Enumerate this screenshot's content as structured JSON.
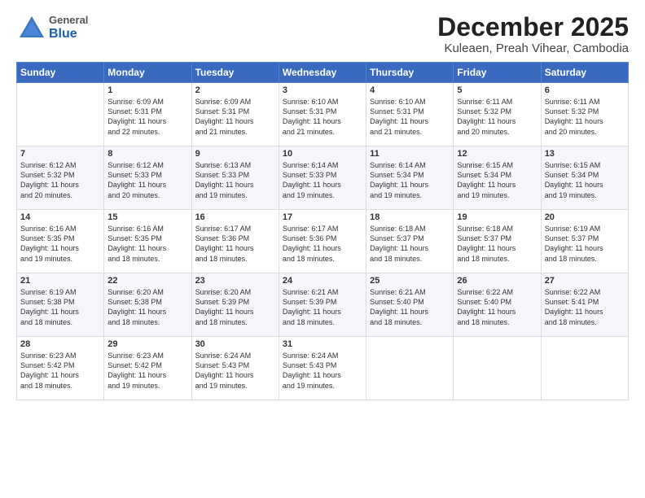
{
  "header": {
    "logo": {
      "general": "General",
      "blue": "Blue"
    },
    "title": "December 2025",
    "subtitle": "Kuleaen, Preah Vihear, Cambodia"
  },
  "calendar": {
    "headers": [
      "Sunday",
      "Monday",
      "Tuesday",
      "Wednesday",
      "Thursday",
      "Friday",
      "Saturday"
    ],
    "weeks": [
      [
        {
          "day": "",
          "info": ""
        },
        {
          "day": "1",
          "info": "Sunrise: 6:09 AM\nSunset: 5:31 PM\nDaylight: 11 hours\nand 22 minutes."
        },
        {
          "day": "2",
          "info": "Sunrise: 6:09 AM\nSunset: 5:31 PM\nDaylight: 11 hours\nand 21 minutes."
        },
        {
          "day": "3",
          "info": "Sunrise: 6:10 AM\nSunset: 5:31 PM\nDaylight: 11 hours\nand 21 minutes."
        },
        {
          "day": "4",
          "info": "Sunrise: 6:10 AM\nSunset: 5:31 PM\nDaylight: 11 hours\nand 21 minutes."
        },
        {
          "day": "5",
          "info": "Sunrise: 6:11 AM\nSunset: 5:32 PM\nDaylight: 11 hours\nand 20 minutes."
        },
        {
          "day": "6",
          "info": "Sunrise: 6:11 AM\nSunset: 5:32 PM\nDaylight: 11 hours\nand 20 minutes."
        }
      ],
      [
        {
          "day": "7",
          "info": "Sunrise: 6:12 AM\nSunset: 5:32 PM\nDaylight: 11 hours\nand 20 minutes."
        },
        {
          "day": "8",
          "info": "Sunrise: 6:12 AM\nSunset: 5:33 PM\nDaylight: 11 hours\nand 20 minutes."
        },
        {
          "day": "9",
          "info": "Sunrise: 6:13 AM\nSunset: 5:33 PM\nDaylight: 11 hours\nand 19 minutes."
        },
        {
          "day": "10",
          "info": "Sunrise: 6:14 AM\nSunset: 5:33 PM\nDaylight: 11 hours\nand 19 minutes."
        },
        {
          "day": "11",
          "info": "Sunrise: 6:14 AM\nSunset: 5:34 PM\nDaylight: 11 hours\nand 19 minutes."
        },
        {
          "day": "12",
          "info": "Sunrise: 6:15 AM\nSunset: 5:34 PM\nDaylight: 11 hours\nand 19 minutes."
        },
        {
          "day": "13",
          "info": "Sunrise: 6:15 AM\nSunset: 5:34 PM\nDaylight: 11 hours\nand 19 minutes."
        }
      ],
      [
        {
          "day": "14",
          "info": "Sunrise: 6:16 AM\nSunset: 5:35 PM\nDaylight: 11 hours\nand 19 minutes."
        },
        {
          "day": "15",
          "info": "Sunrise: 6:16 AM\nSunset: 5:35 PM\nDaylight: 11 hours\nand 18 minutes."
        },
        {
          "day": "16",
          "info": "Sunrise: 6:17 AM\nSunset: 5:36 PM\nDaylight: 11 hours\nand 18 minutes."
        },
        {
          "day": "17",
          "info": "Sunrise: 6:17 AM\nSunset: 5:36 PM\nDaylight: 11 hours\nand 18 minutes."
        },
        {
          "day": "18",
          "info": "Sunrise: 6:18 AM\nSunset: 5:37 PM\nDaylight: 11 hours\nand 18 minutes."
        },
        {
          "day": "19",
          "info": "Sunrise: 6:18 AM\nSunset: 5:37 PM\nDaylight: 11 hours\nand 18 minutes."
        },
        {
          "day": "20",
          "info": "Sunrise: 6:19 AM\nSunset: 5:37 PM\nDaylight: 11 hours\nand 18 minutes."
        }
      ],
      [
        {
          "day": "21",
          "info": "Sunrise: 6:19 AM\nSunset: 5:38 PM\nDaylight: 11 hours\nand 18 minutes."
        },
        {
          "day": "22",
          "info": "Sunrise: 6:20 AM\nSunset: 5:38 PM\nDaylight: 11 hours\nand 18 minutes."
        },
        {
          "day": "23",
          "info": "Sunrise: 6:20 AM\nSunset: 5:39 PM\nDaylight: 11 hours\nand 18 minutes."
        },
        {
          "day": "24",
          "info": "Sunrise: 6:21 AM\nSunset: 5:39 PM\nDaylight: 11 hours\nand 18 minutes."
        },
        {
          "day": "25",
          "info": "Sunrise: 6:21 AM\nSunset: 5:40 PM\nDaylight: 11 hours\nand 18 minutes."
        },
        {
          "day": "26",
          "info": "Sunrise: 6:22 AM\nSunset: 5:40 PM\nDaylight: 11 hours\nand 18 minutes."
        },
        {
          "day": "27",
          "info": "Sunrise: 6:22 AM\nSunset: 5:41 PM\nDaylight: 11 hours\nand 18 minutes."
        }
      ],
      [
        {
          "day": "28",
          "info": "Sunrise: 6:23 AM\nSunset: 5:42 PM\nDaylight: 11 hours\nand 18 minutes."
        },
        {
          "day": "29",
          "info": "Sunrise: 6:23 AM\nSunset: 5:42 PM\nDaylight: 11 hours\nand 19 minutes."
        },
        {
          "day": "30",
          "info": "Sunrise: 6:24 AM\nSunset: 5:43 PM\nDaylight: 11 hours\nand 19 minutes."
        },
        {
          "day": "31",
          "info": "Sunrise: 6:24 AM\nSunset: 5:43 PM\nDaylight: 11 hours\nand 19 minutes."
        },
        {
          "day": "",
          "info": ""
        },
        {
          "day": "",
          "info": ""
        },
        {
          "day": "",
          "info": ""
        }
      ]
    ]
  }
}
